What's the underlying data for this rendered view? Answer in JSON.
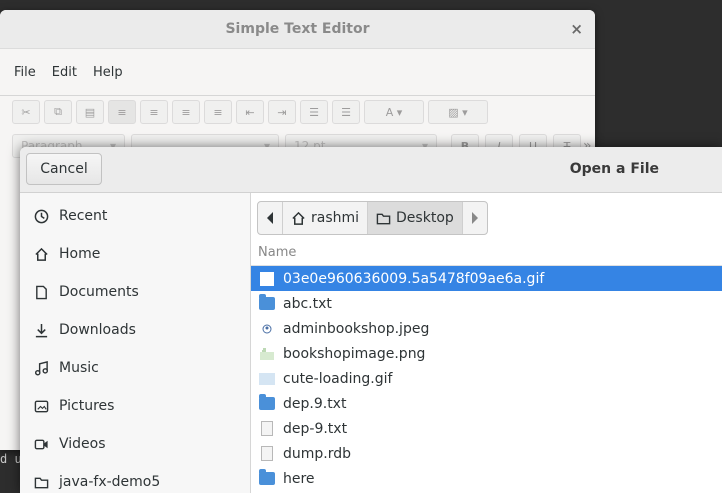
{
  "editor": {
    "title": "Simple Text Editor",
    "close_glyph": "×",
    "menu": [
      "File",
      "Edit",
      "Help"
    ],
    "paragraph_combo": "Paragraph",
    "size_combo": "12 pt",
    "overflow_glyph": "»"
  },
  "background": {
    "terminal_text": "d u"
  },
  "dialog": {
    "title": "Open a File",
    "cancel_label": "Cancel",
    "places": [
      {
        "label": "Recent",
        "icon": "clock-icon"
      },
      {
        "label": "Home",
        "icon": "home-icon"
      },
      {
        "label": "Documents",
        "icon": "document-icon"
      },
      {
        "label": "Downloads",
        "icon": "download-icon"
      },
      {
        "label": "Music",
        "icon": "music-icon"
      },
      {
        "label": "Pictures",
        "icon": "picture-icon"
      },
      {
        "label": "Videos",
        "icon": "video-icon"
      },
      {
        "label": "java-fx-demo5",
        "icon": "folder-icon"
      }
    ],
    "path": {
      "segments": [
        "rashmi",
        "Desktop"
      ],
      "selected": "Desktop"
    },
    "column_name": "Name",
    "files": [
      {
        "name": "03e0e960636009.5a5478f09ae6a.gif",
        "icon": "image-icon",
        "selected": true
      },
      {
        "name": "abc.txt",
        "icon": "folder-icon"
      },
      {
        "name": "adminbookshop.jpeg",
        "icon": "image-icon"
      },
      {
        "name": "bookshopimage.png",
        "icon": "image-icon"
      },
      {
        "name": "cute-loading.gif",
        "icon": "image-icon"
      },
      {
        "name": "dep.9.txt",
        "icon": "folder-icon"
      },
      {
        "name": "dep-9.txt",
        "icon": "text-file-icon"
      },
      {
        "name": "dump.rdb",
        "icon": "file-icon"
      },
      {
        "name": "here",
        "icon": "folder-icon"
      }
    ],
    "accent": "#3584e4"
  }
}
